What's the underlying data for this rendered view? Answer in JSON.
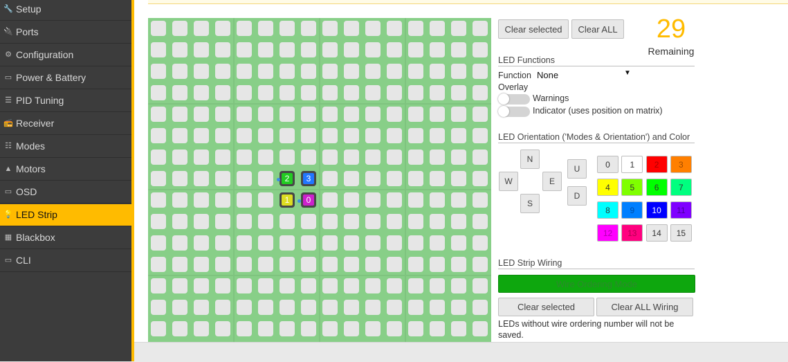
{
  "sidebar": {
    "items": [
      {
        "label": "Setup",
        "icon": "wrench-icon",
        "glyph": "🔧",
        "active": false
      },
      {
        "label": "Ports",
        "icon": "plug-icon",
        "glyph": "🔌",
        "active": false
      },
      {
        "label": "Configuration",
        "icon": "gear-icon",
        "glyph": "⚙",
        "active": false
      },
      {
        "label": "Power & Battery",
        "icon": "battery-icon",
        "glyph": "▭",
        "active": false
      },
      {
        "label": "PID Tuning",
        "icon": "sliders-icon",
        "glyph": "☰",
        "active": false
      },
      {
        "label": "Receiver",
        "icon": "receiver-icon",
        "glyph": "📻",
        "active": false
      },
      {
        "label": "Modes",
        "icon": "toggles-icon",
        "glyph": "☷",
        "active": false
      },
      {
        "label": "Motors",
        "icon": "motor-icon",
        "glyph": "▲",
        "active": false
      },
      {
        "label": "OSD",
        "icon": "osd-icon",
        "glyph": "▭",
        "active": false
      },
      {
        "label": "LED Strip",
        "icon": "bulb-icon",
        "glyph": "💡",
        "active": true
      },
      {
        "label": "Blackbox",
        "icon": "blackbox-icon",
        "glyph": "▦",
        "active": false
      },
      {
        "label": "CLI",
        "icon": "terminal-icon",
        "glyph": "▭",
        "active": false
      }
    ]
  },
  "grid": {
    "columns": 16,
    "rows": 16,
    "leds": [
      {
        "label": "2",
        "row": 7,
        "col": 6,
        "color": "#22cc22"
      },
      {
        "label": "3",
        "row": 7,
        "col": 7,
        "color": "#2277ff"
      },
      {
        "label": "1",
        "row": 8,
        "col": 6,
        "color": "#dddd22"
      },
      {
        "label": "0",
        "row": 8,
        "col": 7,
        "color": "#cc22cc"
      }
    ]
  },
  "toolbar": {
    "clear_selected_label": "Clear selected",
    "clear_all_label": "Clear ALL"
  },
  "remaining": {
    "count": "29",
    "label": "Remaining",
    "color": "#ffbb00"
  },
  "functions": {
    "title": "LED Functions",
    "function_label": "Function",
    "function_value": "None",
    "overlay_label": "Overlay",
    "warnings_label": "Warnings",
    "indicator_label": "Indicator (uses position on matrix)",
    "warnings_on": false,
    "indicator_on": false
  },
  "orientation": {
    "title": "LED Orientation ('Modes & Orientation') and Color",
    "north": "N",
    "west": "W",
    "east": "E",
    "south": "S",
    "up": "U",
    "down": "D"
  },
  "colors": [
    {
      "label": "0",
      "bg": "#e8e8e8",
      "fg": "#333333"
    },
    {
      "label": "1",
      "bg": "#ffffff",
      "fg": "#333333"
    },
    {
      "label": "2",
      "bg": "#ff0000",
      "fg": "#aa0000"
    },
    {
      "label": "3",
      "bg": "#ff7f00",
      "fg": "#a04c00"
    },
    {
      "label": "4",
      "bg": "#ffff00",
      "fg": "#333333"
    },
    {
      "label": "5",
      "bg": "#7fff00",
      "fg": "#333333"
    },
    {
      "label": "6",
      "bg": "#00ff00",
      "fg": "#333333"
    },
    {
      "label": "7",
      "bg": "#00ff7f",
      "fg": "#333333"
    },
    {
      "label": "8",
      "bg": "#00ffff",
      "fg": "#333333"
    },
    {
      "label": "9",
      "bg": "#007fff",
      "fg": "#0050aa"
    },
    {
      "label": "10",
      "bg": "#0000ff",
      "fg": "#ffffff"
    },
    {
      "label": "11",
      "bg": "#7f00ff",
      "fg": "#4a0099"
    },
    {
      "label": "12",
      "bg": "#ff00ff",
      "fg": "#b000b0"
    },
    {
      "label": "13",
      "bg": "#ff007f",
      "fg": "#b00050"
    },
    {
      "label": "14",
      "bg": "#e8e8e8",
      "fg": "#333333"
    },
    {
      "label": "15",
      "bg": "#e8e8e8",
      "fg": "#333333"
    }
  ],
  "wiring": {
    "title": "LED Strip Wiring",
    "mode_label": "Wire Ordering Mode",
    "mode_color": "#0ea70e",
    "clear_selected_label": "Clear selected",
    "clear_all_label": "Clear ALL Wiring",
    "note": "LEDs without wire ordering number will not be saved."
  }
}
